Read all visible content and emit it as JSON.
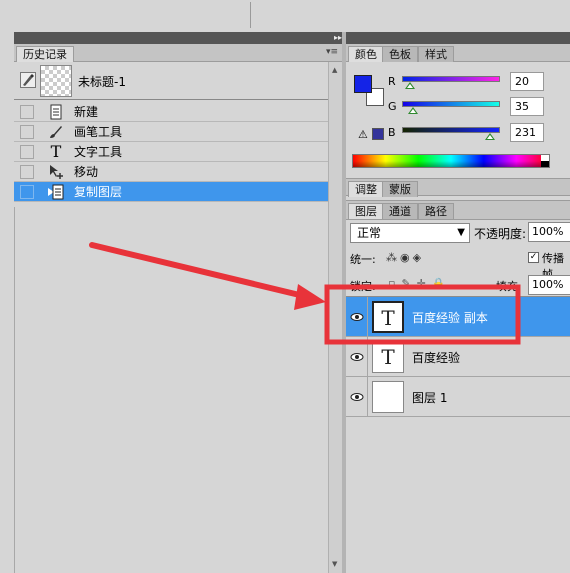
{
  "history_panel": {
    "tab_label": "历史记录",
    "snapshot_label": "未标题-1",
    "items": [
      {
        "label": "新建",
        "icon": "new-doc-icon"
      },
      {
        "label": "画笔工具",
        "icon": "brush-icon"
      },
      {
        "label": "文字工具",
        "icon": "type-tool-icon"
      },
      {
        "label": "移动",
        "icon": "move-icon"
      },
      {
        "label": "复制图层",
        "icon": "duplicate-layer-icon",
        "selected": true
      }
    ]
  },
  "color_panel": {
    "tabs": [
      "颜色",
      "色板",
      "样式"
    ],
    "foreground_color": "#1423e7",
    "r_label": "R",
    "r_value": "20",
    "g_label": "G",
    "g_value": "35",
    "b_label": "B",
    "b_value": "231"
  },
  "adjust_tabs": [
    "调整",
    "蒙版"
  ],
  "layers_panel": {
    "tabs": [
      "图层",
      "通道",
      "路径"
    ],
    "blend_mode": "正常",
    "opacity_label": "不透明度:",
    "opacity_value": "100%",
    "unify_label": "统一:",
    "propagate_label": "传播帧",
    "lock_label": "锁定:",
    "fill_label": "填充:",
    "fill_value": "100%",
    "layers": [
      {
        "name": "百度经验 副本",
        "type": "text",
        "thumb": "T",
        "selected": true
      },
      {
        "name": "百度经验",
        "type": "text",
        "thumb": "T"
      },
      {
        "name": "图层 1",
        "type": "raster",
        "thumb": ""
      }
    ]
  },
  "annotation": {
    "color": "#e8333a"
  }
}
